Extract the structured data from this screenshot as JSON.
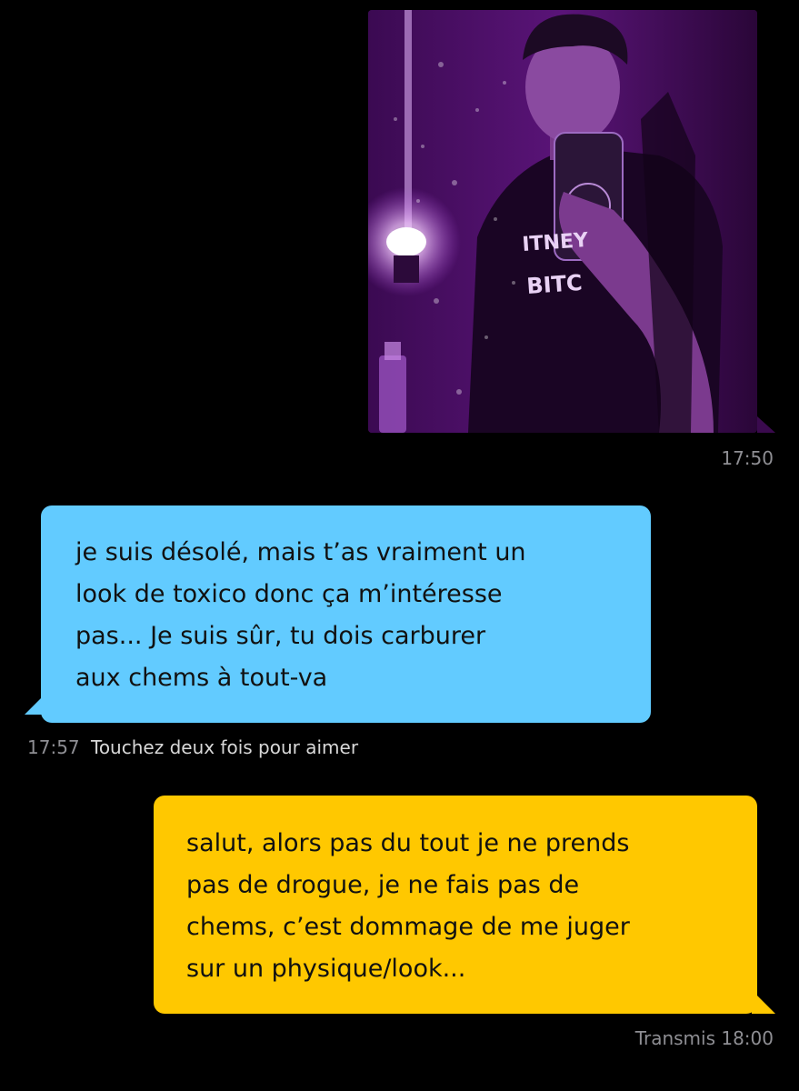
{
  "conversation": {
    "photo_message": {
      "timestamp": "17:50",
      "shirt_print": [
        "ITNEY",
        "BITC"
      ]
    },
    "received_message": {
      "lines": [
        "je suis désolé, mais t’as vraiment un",
        "look de toxico donc ça m’intéresse",
        "pas... Je suis sûr, tu dois carburer",
        "aux chems à tout-va"
      ],
      "timestamp": "17:57",
      "hint": "Touchez deux fois pour aimer",
      "color": "#62cbff"
    },
    "sent_message": {
      "lines": [
        "salut, alors pas du tout je ne prends",
        "pas de drogue, je ne fais pas de",
        "chems, c’est dommage de me juger",
        "sur un physique/look..."
      ],
      "status": "Transmis 18:00",
      "color": "#ffc800"
    }
  },
  "colors": {
    "background": "#000000",
    "timestamp": "#8e8e93",
    "photo_tint": "#6a1b8a"
  }
}
